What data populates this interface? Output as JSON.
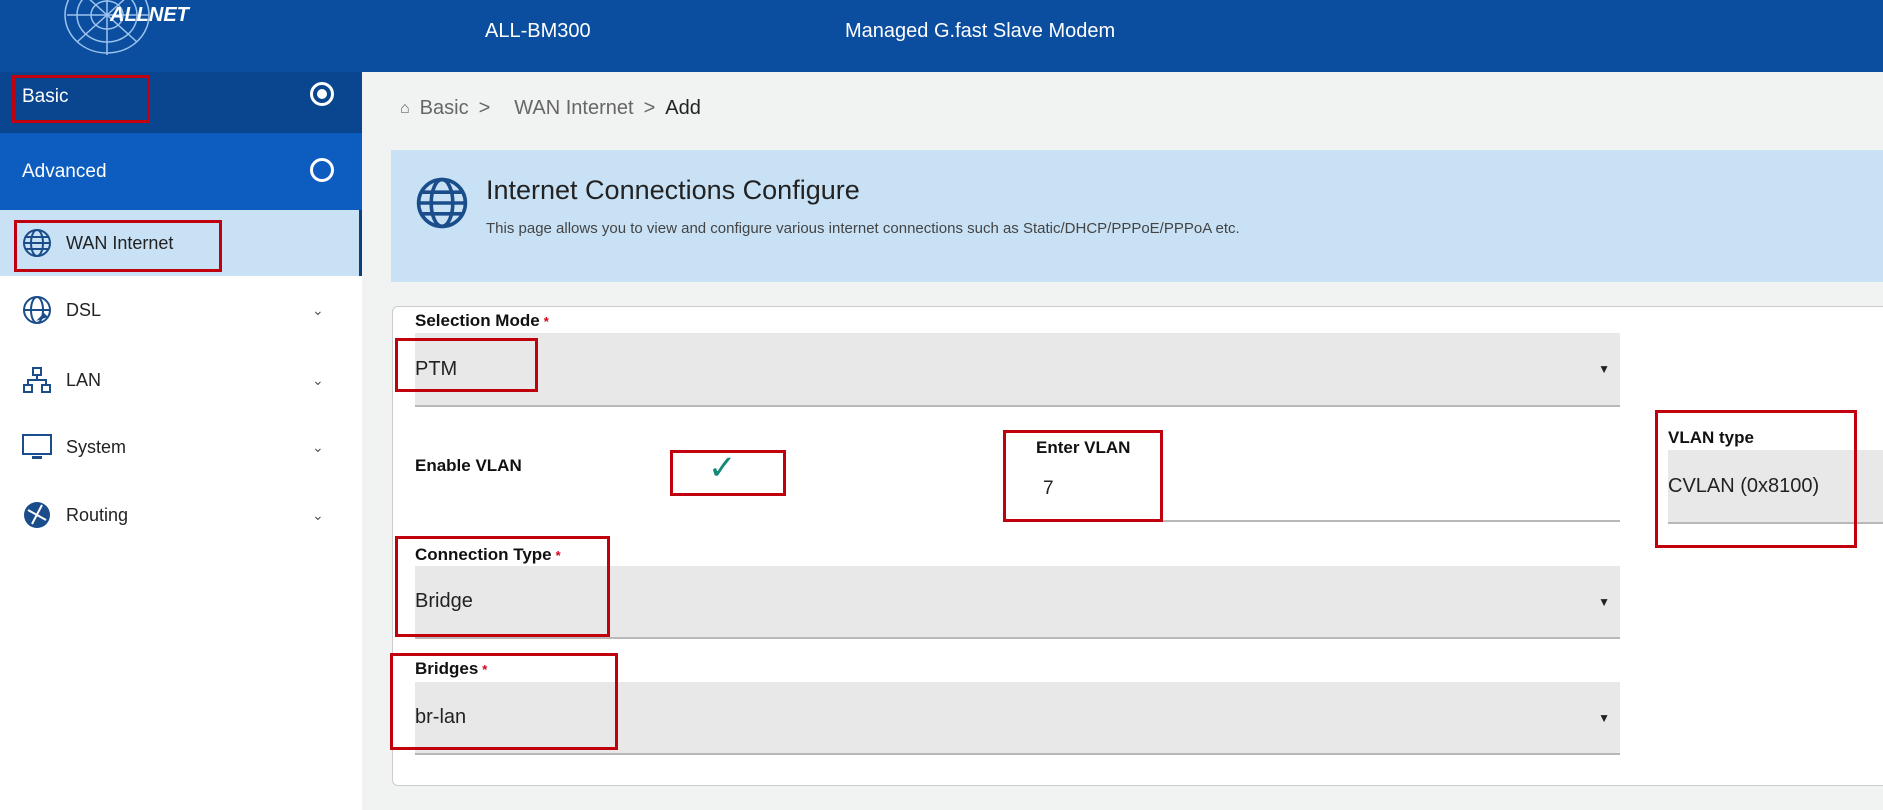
{
  "header": {
    "logo": "ALLNET",
    "model": "ALL-BM300",
    "description": "Managed G.fast Slave Modem"
  },
  "sidebar": {
    "basic": "Basic",
    "advanced": "Advanced",
    "items": [
      {
        "label": "WAN Internet",
        "icon": "globe-icon",
        "active": true
      },
      {
        "label": "DSL",
        "icon": "dsl-globe-icon"
      },
      {
        "label": "LAN",
        "icon": "network-icon"
      },
      {
        "label": "System",
        "icon": "monitor-icon"
      },
      {
        "label": "Routing",
        "icon": "routing-icon"
      }
    ]
  },
  "breadcrumb": {
    "items": [
      "Basic",
      "WAN Internet",
      "Add"
    ],
    "sep": ">"
  },
  "banner": {
    "title": "Internet Connections Configure",
    "description": "This page allows you to view and configure various internet connections such as Static/DHCP/PPPoE/PPPoA etc."
  },
  "form": {
    "selection_mode": {
      "label": "Selection Mode",
      "required": "*",
      "value": "PTM"
    },
    "enable_vlan": {
      "label": "Enable VLAN",
      "checked": true,
      "mark": "✓"
    },
    "enter_vlan": {
      "label": "Enter VLAN",
      "value": "7"
    },
    "vlan_type": {
      "label": "VLAN type",
      "value": "CVLAN (0x8100)"
    },
    "connection_type": {
      "label": "Connection Type",
      "required": "*",
      "value": "Bridge"
    },
    "bridges": {
      "label": "Bridges",
      "required": "*",
      "value": "br-lan"
    }
  },
  "colors": {
    "header": "#0b4e9f",
    "annotation": "#c0000c",
    "accent_light": "#c8e1f5"
  }
}
